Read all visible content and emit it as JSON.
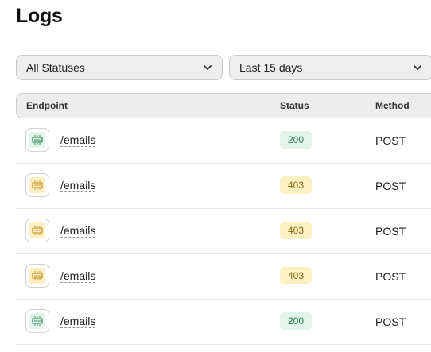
{
  "page": {
    "title": "Logs"
  },
  "filters": {
    "status": {
      "value": "All Statuses"
    },
    "range": {
      "value": "Last 15 days"
    }
  },
  "table": {
    "columns": [
      "Endpoint",
      "Status",
      "Method"
    ],
    "rows": [
      {
        "endpoint": "/emails",
        "status": "200",
        "method": "POST",
        "kind": "success"
      },
      {
        "endpoint": "/emails",
        "status": "403",
        "method": "POST",
        "kind": "warning"
      },
      {
        "endpoint": "/emails",
        "status": "403",
        "method": "POST",
        "kind": "warning"
      },
      {
        "endpoint": "/emails",
        "status": "403",
        "method": "POST",
        "kind": "warning"
      },
      {
        "endpoint": "/emails",
        "status": "200",
        "method": "POST",
        "kind": "success"
      }
    ]
  },
  "colors": {
    "success_bg": "#e3f4ea",
    "success_text": "#2f7d4f",
    "success_icon": "#3b8f62",
    "warning_bg": "#fdf1c4",
    "warning_text": "#8a6716",
    "warning_icon": "#c9952a"
  },
  "icons": {
    "endpoint": "api-endpoint-icon",
    "dropdown": "chevron-down-icon"
  }
}
